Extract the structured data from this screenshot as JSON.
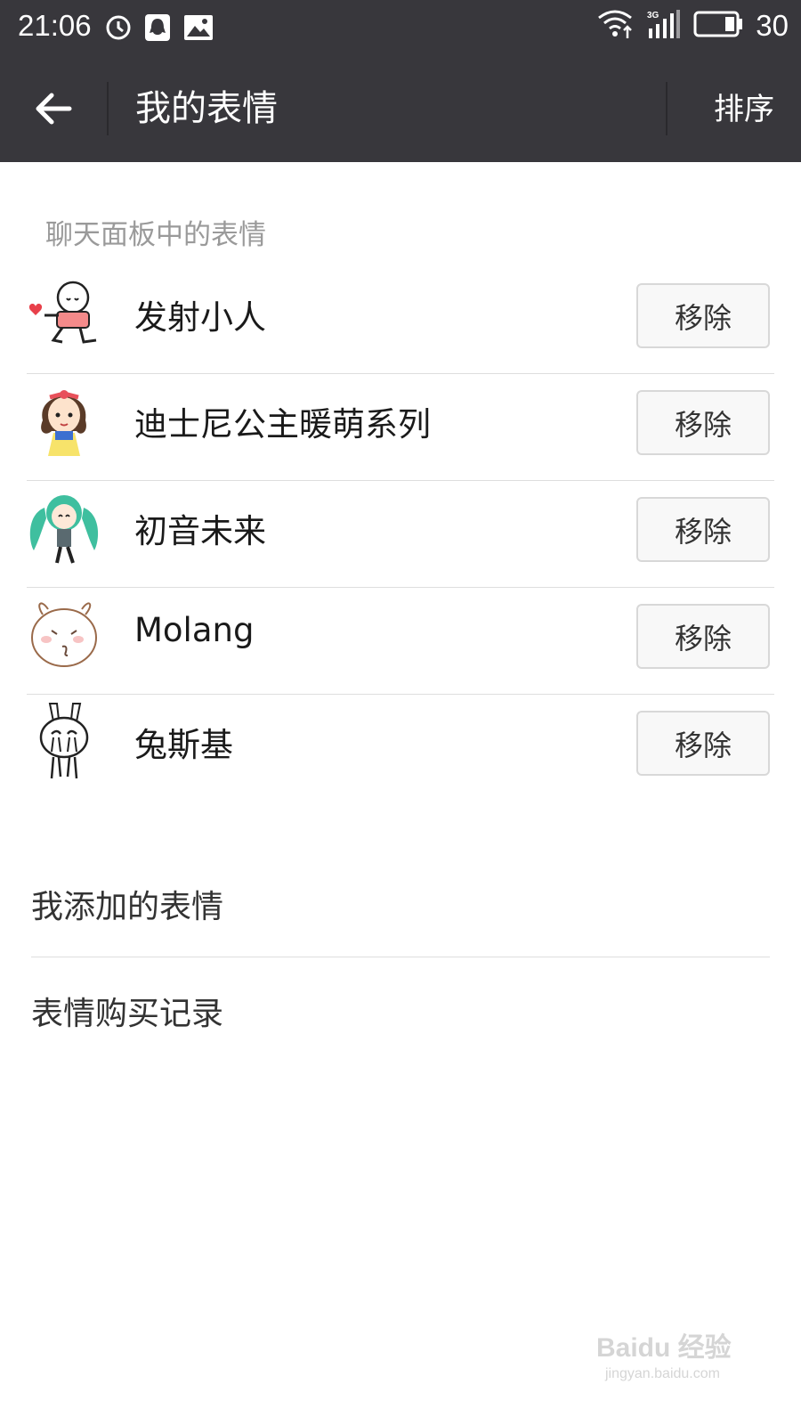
{
  "status_bar": {
    "time": "21:06",
    "battery_level": "30",
    "left_icons": [
      "clock-icon",
      "qq-icon",
      "image-icon"
    ],
    "right_icons": [
      "wifi-icon",
      "signal-3g-icon",
      "battery-icon"
    ],
    "network_type": "3G"
  },
  "app_bar": {
    "title": "我的表情",
    "sort_label": "排序",
    "background_color": "#38373c"
  },
  "section": {
    "label": "聊天面板中的表情"
  },
  "stickers": [
    {
      "name": "发射小人",
      "remove_label": "移除",
      "thumb_icon": "heart-shooter-icon"
    },
    {
      "name": "迪士尼公主暖萌系列",
      "remove_label": "移除",
      "thumb_icon": "princess-icon"
    },
    {
      "name": "初音未来",
      "remove_label": "移除",
      "thumb_icon": "miku-icon"
    },
    {
      "name": "Molang",
      "remove_label": "移除",
      "thumb_icon": "molang-icon"
    },
    {
      "name": "兔斯基",
      "remove_label": "移除",
      "thumb_icon": "tuzki-icon"
    }
  ],
  "menu": {
    "items": [
      {
        "label": "我添加的表情"
      },
      {
        "label": "表情购买记录"
      }
    ]
  },
  "watermark": {
    "brand": "Baidu 经验",
    "url": "jingyan.baidu.com"
  }
}
